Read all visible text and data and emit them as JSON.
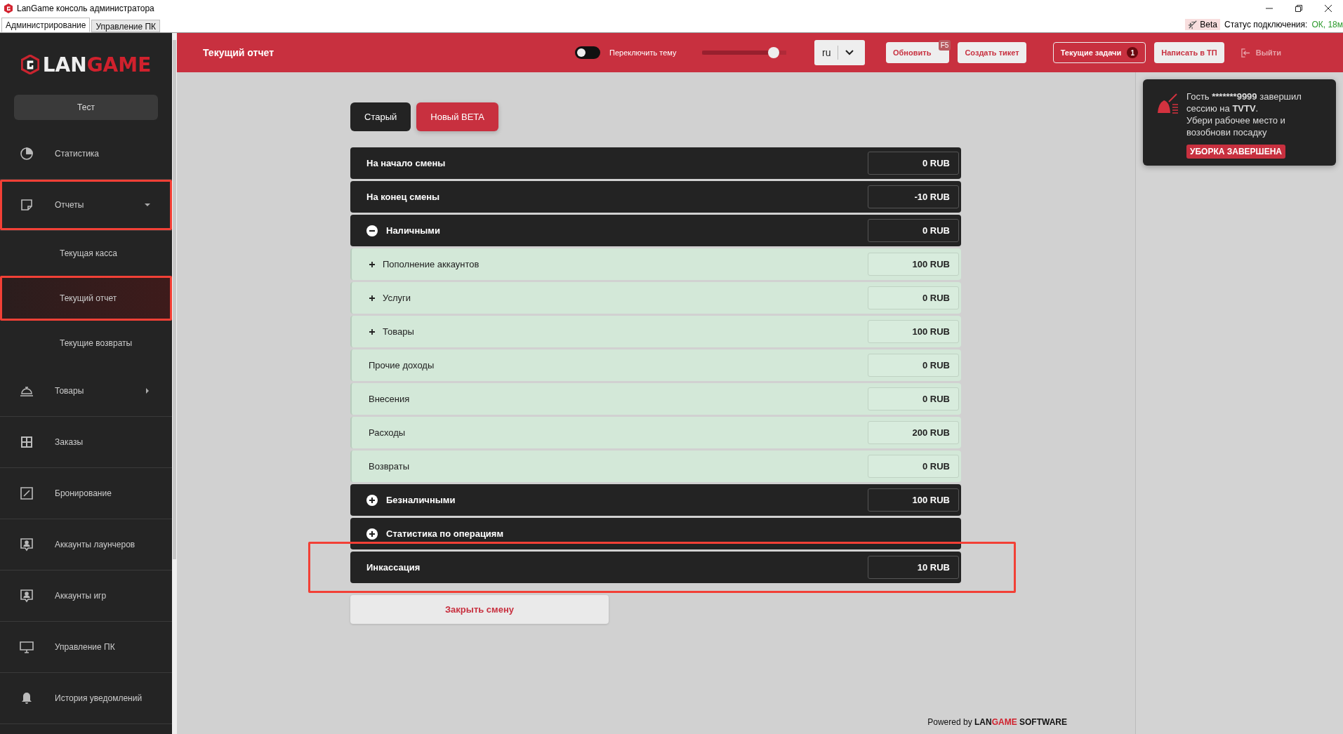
{
  "window": {
    "title": "LanGame консоль администратора"
  },
  "app_tabs": [
    {
      "label": "Администрирование",
      "selected": true
    },
    {
      "label": "Управление ПК",
      "selected": false
    }
  ],
  "status": {
    "badge": "Beta",
    "label": "Статус подключения:",
    "value": "ОК, 18м"
  },
  "logo": {
    "part1": "LAN",
    "part2": "GAME"
  },
  "sidebar": {
    "profile": "Тест",
    "items": [
      {
        "label": "Статистика",
        "highlighted": false
      },
      {
        "label": "Отчеты",
        "expanded": true,
        "highlighted": true,
        "children": [
          {
            "label": "Текущая касса",
            "selected": false,
            "highlighted": false
          },
          {
            "label": "Текущий отчет",
            "selected": true,
            "highlighted": true
          },
          {
            "label": "Текущие возвраты",
            "selected": false,
            "highlighted": false
          }
        ]
      },
      {
        "label": "Товары",
        "expanded": false,
        "highlighted": false
      },
      {
        "label": "Заказы",
        "highlighted": false
      },
      {
        "label": "Бронирование",
        "highlighted": false
      },
      {
        "label": "Аккаунты лаунчеров",
        "highlighted": false
      },
      {
        "label": "Аккаунты игр",
        "highlighted": false
      },
      {
        "label": "Управление ПК",
        "highlighted": false
      },
      {
        "label": "История уведомлений",
        "highlighted": false
      }
    ]
  },
  "header": {
    "title": "Текущий отчет",
    "theme_toggle": {
      "label": "Переключить тему",
      "on": false
    },
    "slider": {
      "level": 0.85
    },
    "language": "ru",
    "buttons": [
      {
        "label": "Обновить",
        "kind": "light",
        "shortcut": "F5"
      },
      {
        "label": "Создать тикет",
        "kind": "light"
      },
      {
        "label": "Текущие задачи",
        "kind": "outline",
        "count": "1"
      },
      {
        "label": "Написать в ТП",
        "kind": "light"
      },
      {
        "label": "Выйти",
        "kind": "ghost"
      }
    ]
  },
  "mode_tabs": [
    {
      "label": "Старый",
      "selected": false
    },
    {
      "label": "Новый BETA",
      "selected": true
    }
  ],
  "report_rows": [
    {
      "kind": "total",
      "label": "На начало смены",
      "value": "0 RUB",
      "highlighted": false
    },
    {
      "kind": "total",
      "label": "На конец смены",
      "value": "-10 RUB",
      "highlighted": false
    },
    {
      "kind": "total",
      "label": "Наличными",
      "value": "0 RUB",
      "expanded": true,
      "highlighted": false
    },
    {
      "kind": "detail",
      "label": "Пополнение аккаунтов",
      "value": "100 RUB",
      "expanded": false,
      "highlighted": false
    },
    {
      "kind": "detail",
      "label": "Услуги",
      "value": "0 RUB",
      "expanded": false,
      "highlighted": false
    },
    {
      "kind": "detail",
      "label": "Товары",
      "value": "100 RUB",
      "expanded": false,
      "highlighted": false
    },
    {
      "kind": "detail",
      "label": "Прочие доходы",
      "value": "0 RUB",
      "highlighted": false
    },
    {
      "kind": "detail",
      "label": "Внесения",
      "value": "0 RUB",
      "highlighted": false
    },
    {
      "kind": "detail",
      "label": "Расходы",
      "value": "200 RUB",
      "highlighted": false
    },
    {
      "kind": "detail",
      "label": "Возвраты",
      "value": "0 RUB",
      "highlighted": false
    },
    {
      "kind": "total",
      "label": "Безналичными",
      "value": "100 RUB",
      "expanded": false,
      "highlighted": false
    },
    {
      "kind": "total",
      "label": "Статистика по операциям",
      "expanded": false,
      "highlighted": false
    },
    {
      "kind": "total",
      "label": "Инкассация",
      "value": "10 RUB",
      "highlighted": true
    }
  ],
  "close_shift_button": "Закрыть смену",
  "footer": {
    "prefix": "Powered by",
    "brand1": "LAN",
    "brand2": "GAME",
    "suffix": "SOFTWARE"
  },
  "notification": {
    "parts": [
      {
        "text": "Гость "
      },
      {
        "text": "*******9999",
        "bold": true
      },
      {
        "text": " завершил сессию на "
      },
      {
        "text": "TVTV",
        "bold": true
      },
      {
        "text": "."
      }
    ],
    "message": "Убери рабочее место и возобнови посадку",
    "action": "УБОРКА ЗАВЕРШЕНА"
  }
}
